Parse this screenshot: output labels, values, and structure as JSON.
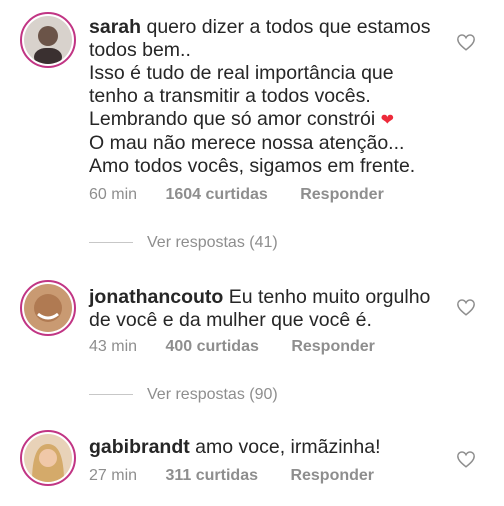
{
  "comments": [
    {
      "username": "sarah",
      "lines": [
        "quero dizer a todos que estamos",
        "todos bem..",
        "Isso é tudo de real importância que",
        "tenho a transmitir a todos vocês.",
        "Lembrando que só amor constrói",
        "O mau não merece nossa atenção...",
        "Amo todos vocês, sigamos em frente."
      ],
      "emoji": "❤",
      "time": "60 min",
      "likes": "1604 curtidas",
      "reply_label": "Responder",
      "view_replies": "Ver respostas (41)",
      "avatar_icon": "user-avatar-icon"
    },
    {
      "username": "jonathancouto",
      "lines": [
        "Eu tenho muito orgulho",
        "de você e da mulher que você é."
      ],
      "time": "43 min",
      "likes": "400 curtidas",
      "reply_label": "Responder",
      "view_replies": "Ver respostas (90)",
      "avatar_icon": "user-avatar-icon"
    },
    {
      "username": "gabibrandt",
      "lines": [
        "amo voce, irmãzinha!"
      ],
      "time": "27 min",
      "likes": "311 curtidas",
      "reply_label": "Responder",
      "avatar_icon": "user-avatar-icon"
    }
  ],
  "colors": {
    "text": "#262626",
    "meta": "#8e8e8e",
    "story_ring": "#c13584",
    "emoji_heart": "#ed2a3a"
  }
}
